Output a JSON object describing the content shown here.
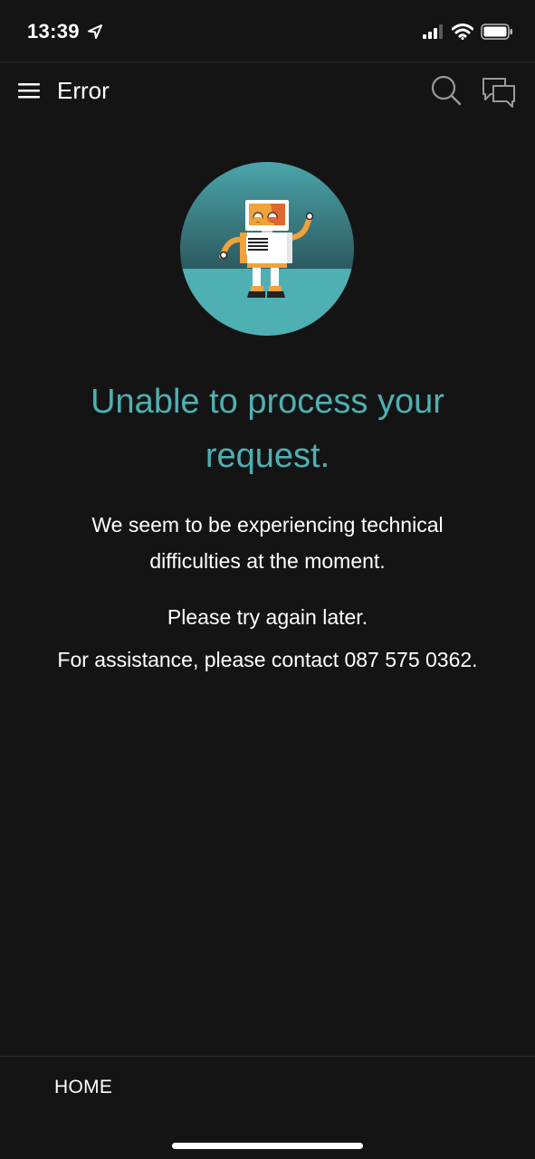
{
  "status_bar": {
    "time": "13:39"
  },
  "app_bar": {
    "title": "Error"
  },
  "error": {
    "heading": "Unable to process your request.",
    "message": "We seem to be experiencing technical difficulties at the moment.",
    "retry": "Please try again later.",
    "assistance": "For assistance, please contact 087 575 0362."
  },
  "bottom_nav": {
    "home_label": "HOME"
  },
  "icons": {
    "menu": "hamburger-menu-icon",
    "search": "search-icon",
    "chat": "chat-bubbles-icon",
    "location": "location-arrow-icon",
    "signal": "cellular-signal-icon",
    "wifi": "wifi-icon",
    "battery": "battery-icon"
  },
  "colors": {
    "background": "#141414",
    "accent": "#4fb0b3",
    "text": "#ffffff",
    "robot_orange": "#f0a23b"
  }
}
